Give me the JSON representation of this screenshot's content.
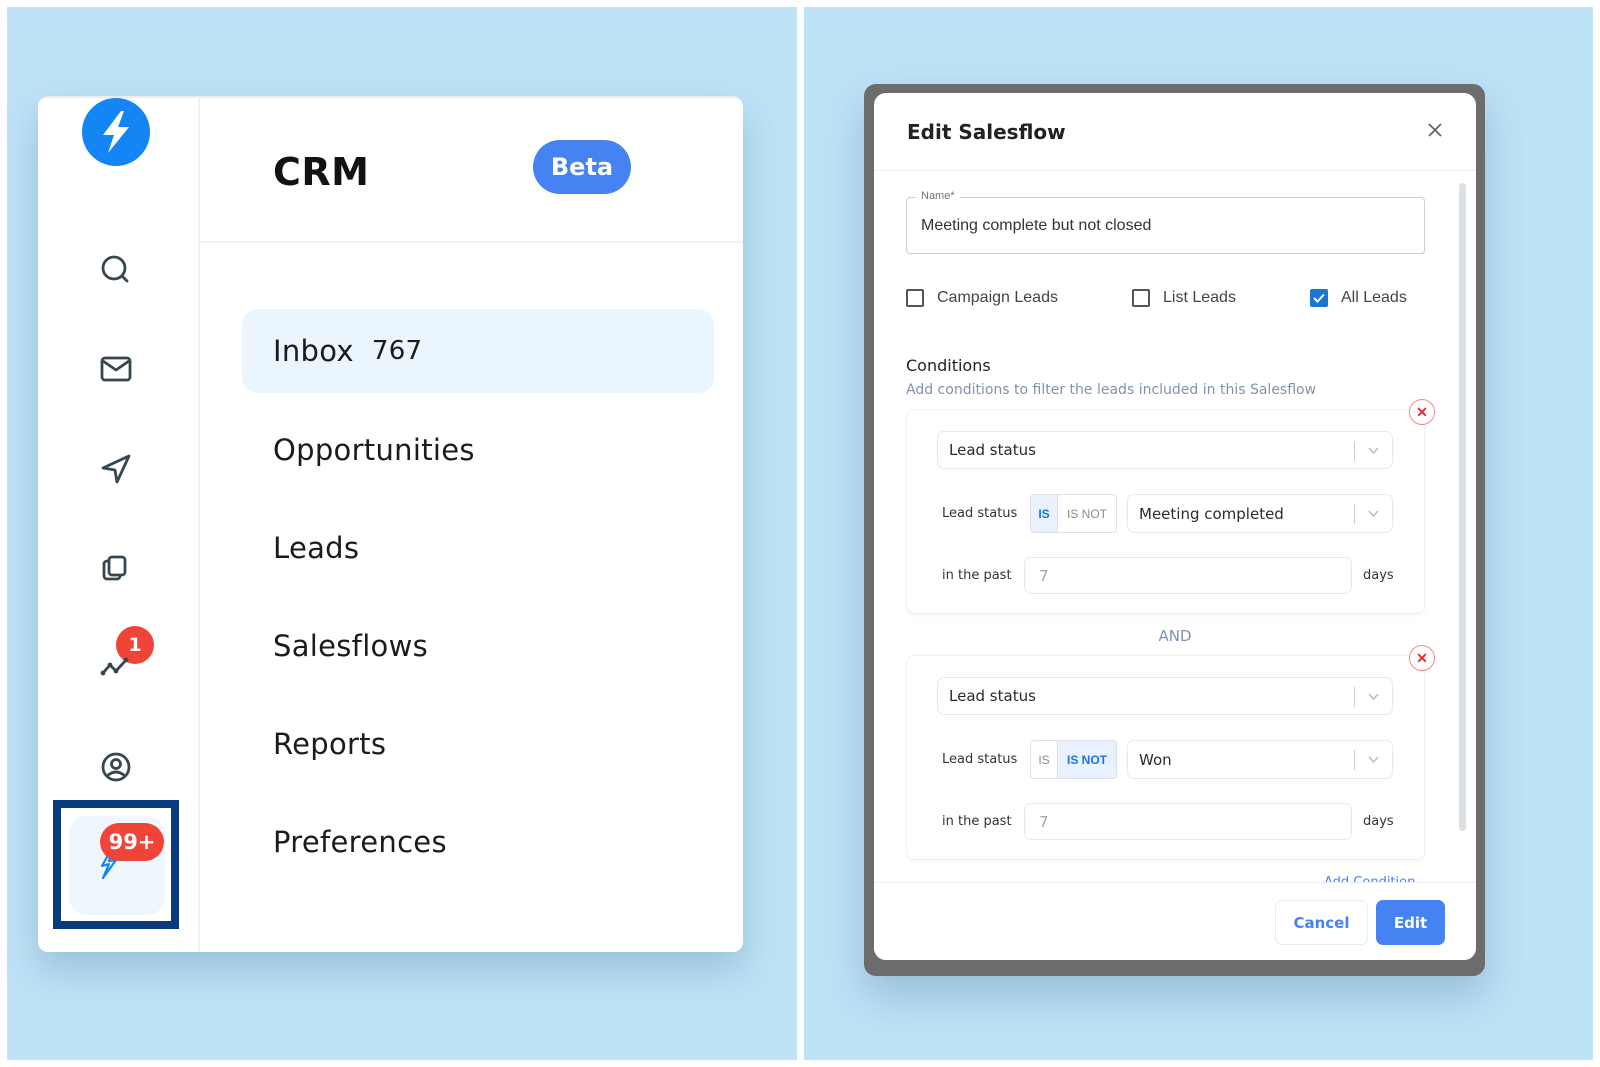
{
  "left_panel": {
    "app": {
      "logo": "lightning-bolt-logo",
      "title": "CRM",
      "badge": "Beta",
      "accent_color": "#4683f2"
    },
    "rail": {
      "icons": [
        {
          "name": "search-icon"
        },
        {
          "name": "mail-icon"
        },
        {
          "name": "send-icon"
        },
        {
          "name": "copy-icon",
          "badge": "1"
        },
        {
          "name": "activity-icon"
        },
        {
          "name": "user-circle-icon"
        },
        {
          "name": "crm-bolt-icon",
          "badge": "99+",
          "highlighted": true
        }
      ]
    },
    "nav": [
      {
        "label": "Inbox",
        "count": "767",
        "active": true
      },
      {
        "label": "Opportunities"
      },
      {
        "label": "Leads"
      },
      {
        "label": "Salesflows"
      },
      {
        "label": "Reports"
      },
      {
        "label": "Preferences"
      }
    ]
  },
  "modal": {
    "title": "Edit Salesflow",
    "close_icon": "close-icon",
    "name_field": {
      "label": "Name*",
      "value": "Meeting complete but not closed"
    },
    "lead_sources": [
      {
        "label": "Campaign Leads",
        "checked": false
      },
      {
        "label": "List Leads",
        "checked": false
      },
      {
        "label": "All Leads",
        "checked": true
      }
    ],
    "conditions": {
      "title": "Conditions",
      "subtitle": "Add conditions to filter the leads included in this Salesflow",
      "joiner": "AND",
      "items": [
        {
          "field": "Lead status",
          "row_label": "Lead status",
          "operator_options": [
            "IS",
            "IS NOT"
          ],
          "operator": "IS",
          "value": "Meeting completed",
          "past_label": "in the past",
          "days": "7",
          "days_unit": "days"
        },
        {
          "field": "Lead status",
          "row_label": "Lead status",
          "operator_options": [
            "IS",
            "IS NOT"
          ],
          "operator": "IS NOT",
          "value": "Won",
          "past_label": "in the past",
          "days": "7",
          "days_unit": "days"
        }
      ],
      "add_condition_label": "Add Condition"
    },
    "footer": {
      "cancel_label": "Cancel",
      "submit_label": "Edit"
    }
  }
}
